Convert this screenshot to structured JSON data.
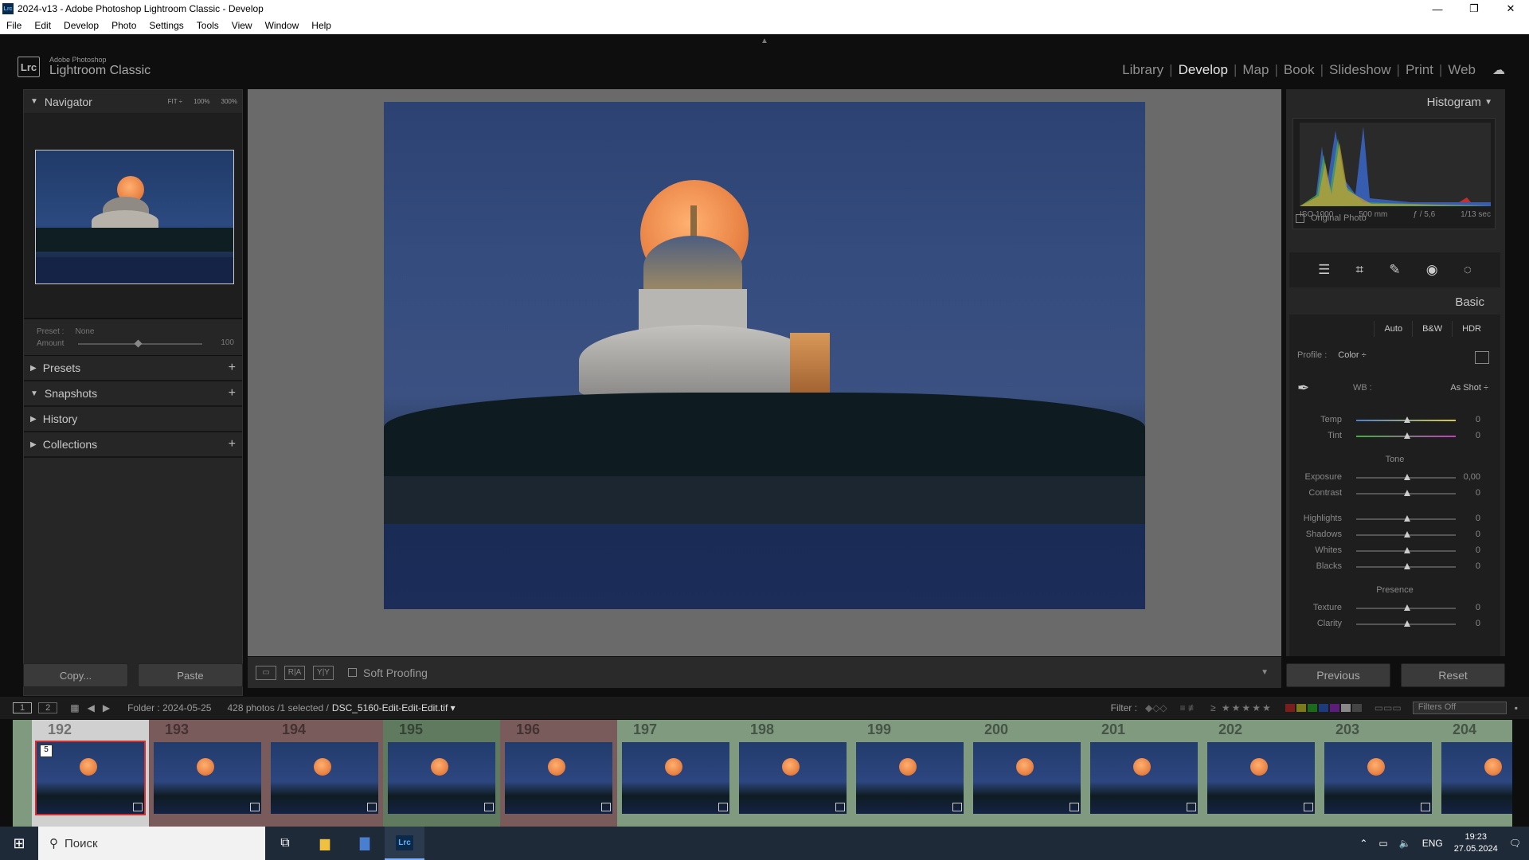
{
  "window": {
    "title": "2024-v13 - Adobe Photoshop Lightroom Classic - Develop",
    "app_icon": "Lrc",
    "minimize": "—",
    "maximize": "❐",
    "close": "✕"
  },
  "menu": [
    "File",
    "Edit",
    "Develop",
    "Photo",
    "Settings",
    "Tools",
    "View",
    "Window",
    "Help"
  ],
  "brand": {
    "logo": "Lrc",
    "line1": "Adobe Photoshop",
    "line2": "Lightroom Classic"
  },
  "modules": [
    {
      "label": "Library",
      "active": false
    },
    {
      "label": "Develop",
      "active": true
    },
    {
      "label": "Map",
      "active": false
    },
    {
      "label": "Book",
      "active": false
    },
    {
      "label": "Slideshow",
      "active": false
    },
    {
      "label": "Print",
      "active": false
    },
    {
      "label": "Web",
      "active": false
    }
  ],
  "navigator": {
    "title": "Navigator",
    "zoom": [
      "FIT ÷",
      "100%",
      "300%"
    ]
  },
  "preset": {
    "label": "Preset :",
    "value": "None",
    "amount_label": "Amount",
    "amount_value": "100"
  },
  "left_sections": [
    {
      "label": "Presets",
      "plus": true
    },
    {
      "label": "Snapshots",
      "plus": true
    },
    {
      "label": "History",
      "plus": false
    },
    {
      "label": "Collections",
      "plus": true
    }
  ],
  "left_buttons": {
    "copy": "Copy...",
    "paste": "Paste"
  },
  "toolbar": {
    "soft_proofing": "Soft Proofing"
  },
  "histogram": {
    "title": "Histogram",
    "iso": "ISO 1000",
    "focal": "500 mm",
    "aperture": "ƒ / 5,6",
    "shutter": "1/13 sec",
    "original": "Original Photo"
  },
  "basic": {
    "title": "Basic",
    "segments": [
      "Auto",
      "B&W",
      "HDR"
    ],
    "profile_label": "Profile :",
    "profile_value": "Color ÷",
    "wb_label": "WB :",
    "wb_value": "As Shot ÷",
    "tone_title": "Tone",
    "presence_title": "Presence",
    "sliders_wb": [
      {
        "label": "Temp",
        "value": "0"
      },
      {
        "label": "Tint",
        "value": "0"
      }
    ],
    "sliders_tone": [
      {
        "label": "Exposure",
        "value": "0,00"
      },
      {
        "label": "Contrast",
        "value": "0"
      }
    ],
    "sliders_tone2": [
      {
        "label": "Highlights",
        "value": "0"
      },
      {
        "label": "Shadows",
        "value": "0"
      },
      {
        "label": "Whites",
        "value": "0"
      },
      {
        "label": "Blacks",
        "value": "0"
      }
    ],
    "sliders_presence": [
      {
        "label": "Texture",
        "value": "0"
      },
      {
        "label": "Clarity",
        "value": "0"
      }
    ]
  },
  "right_buttons": {
    "previous": "Previous",
    "reset": "Reset"
  },
  "filmbar": {
    "view1": "1",
    "view2": "2",
    "folder": "Folder : 2024-05-25",
    "count": "428 photos /1 selected /",
    "filename": "DSC_5160-Edit-Edit-Edit.tif ▾",
    "filter_label": "Filter :",
    "filters_off": "Filters Off"
  },
  "filmstrip": [
    {
      "num": "192",
      "bg": "#d0d0d0",
      "selected": true,
      "stars": "5"
    },
    {
      "num": "193",
      "bg": "#7a5b5b"
    },
    {
      "num": "194",
      "bg": "#7a5b5b"
    },
    {
      "num": "195",
      "bg": "#5f7a5f"
    },
    {
      "num": "196",
      "bg": "#7a5b5b"
    },
    {
      "num": "197",
      "bg": "#7f9a7f"
    },
    {
      "num": "198",
      "bg": "#7f9a7f"
    },
    {
      "num": "199",
      "bg": "#7f9a7f"
    },
    {
      "num": "200",
      "bg": "#7f9a7f"
    },
    {
      "num": "201",
      "bg": "#7f9a7f"
    },
    {
      "num": "202",
      "bg": "#7f9a7f"
    },
    {
      "num": "203",
      "bg": "#7f9a7f"
    },
    {
      "num": "204",
      "bg": "#7f9a7f"
    }
  ],
  "taskbar": {
    "search": "Поиск",
    "lang": "ENG",
    "time": "19:23",
    "date": "27.05.2024"
  }
}
